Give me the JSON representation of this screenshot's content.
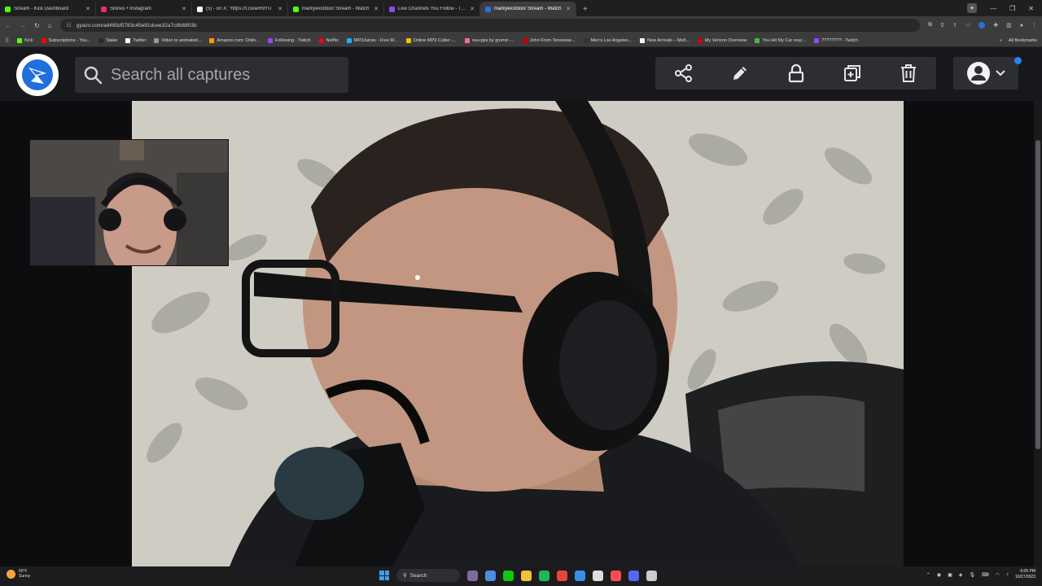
{
  "browser": {
    "tabs": [
      {
        "title": "Stream - Kick Dashboard",
        "color": "#53fc18",
        "active": false
      },
      {
        "title": "Stories • Instagram",
        "color": "#e1306c",
        "active": false
      },
      {
        "title": "(5) - on X: \"https://t.co/eiR9YU",
        "color": "#ffffff",
        "active": false
      },
      {
        "title": "markyexxtdoor Stream - Watch",
        "color": "#53fc18",
        "active": false
      },
      {
        "title": "Live Channels You Follow - Twit",
        "color": "#9146ff",
        "active": false
      },
      {
        "title": "markyexxtdoor Stream - Watch",
        "color": "#2c6fd6",
        "active": true
      }
    ],
    "url": "gyazo.com/ad485d5783c45e91dcee32a7c8b6803b",
    "bookmarks": [
      {
        "label": "Kick",
        "color": "#53fc18"
      },
      {
        "label": "Subscriptions - You...",
        "color": "#ff0000"
      },
      {
        "label": "Stake",
        "color": "#1a2c38"
      },
      {
        "label": "Twitter",
        "color": "#ffffff"
      },
      {
        "label": "Video to animated...",
        "color": "#999999"
      },
      {
        "label": "Amazon.com: Onlin...",
        "color": "#ff9900"
      },
      {
        "label": "Following - Twitch",
        "color": "#9146ff"
      },
      {
        "label": "Netflix",
        "color": "#e50914"
      },
      {
        "label": "MP3Juices - Free M...",
        "color": "#22aaff"
      },
      {
        "label": "Online MP3 Cutter -...",
        "color": "#f5c000"
      },
      {
        "label": "osu-pps by grumd -...",
        "color": "#ff66aa"
      },
      {
        "label": "John From Tennesse...",
        "color": "#cc0000"
      },
      {
        "label": "Men's Los Angeles...",
        "color": "#333333"
      },
      {
        "label": "New Arrivals – Melt...",
        "color": "#ffffff"
      },
      {
        "label": "My Verizon Overview",
        "color": "#cd040b"
      },
      {
        "label": "You Hit My Car reac...",
        "color": "#44bb44"
      },
      {
        "label": "???????? - Twitch",
        "color": "#9146ff"
      }
    ],
    "all_bookmarks": "All Bookmarks"
  },
  "gyazo": {
    "search_placeholder": "Search all captures",
    "tools": [
      "share-icon",
      "pencil-icon",
      "lock-icon",
      "duplicate-icon",
      "trash-icon"
    ],
    "accent": "#2f80ed"
  },
  "taskbar": {
    "weather_temp": "60°F",
    "weather_desc": "Sunny",
    "search_label": "Search",
    "time": "6:05 PM",
    "date": "10/27/2023",
    "pinned": [
      {
        "name": "file-explorer-icon",
        "color": "#7e6a9e"
      },
      {
        "name": "app-icon-1",
        "color": "#4a8fe0"
      },
      {
        "name": "app-icon-2",
        "color": "#16c60c"
      },
      {
        "name": "folder-icon",
        "color": "#f3c13a"
      },
      {
        "name": "spotify-icon",
        "color": "#1db954"
      },
      {
        "name": "chrome-icon",
        "color": "#e8453c"
      },
      {
        "name": "app-icon-3",
        "color": "#3a8ee6"
      },
      {
        "name": "app-icon-4",
        "color": "#dddddd"
      },
      {
        "name": "app-icon-5",
        "color": "#ff4b4b"
      },
      {
        "name": "discord-icon",
        "color": "#5865f2"
      },
      {
        "name": "app-icon-6",
        "color": "#cccccc"
      }
    ]
  }
}
